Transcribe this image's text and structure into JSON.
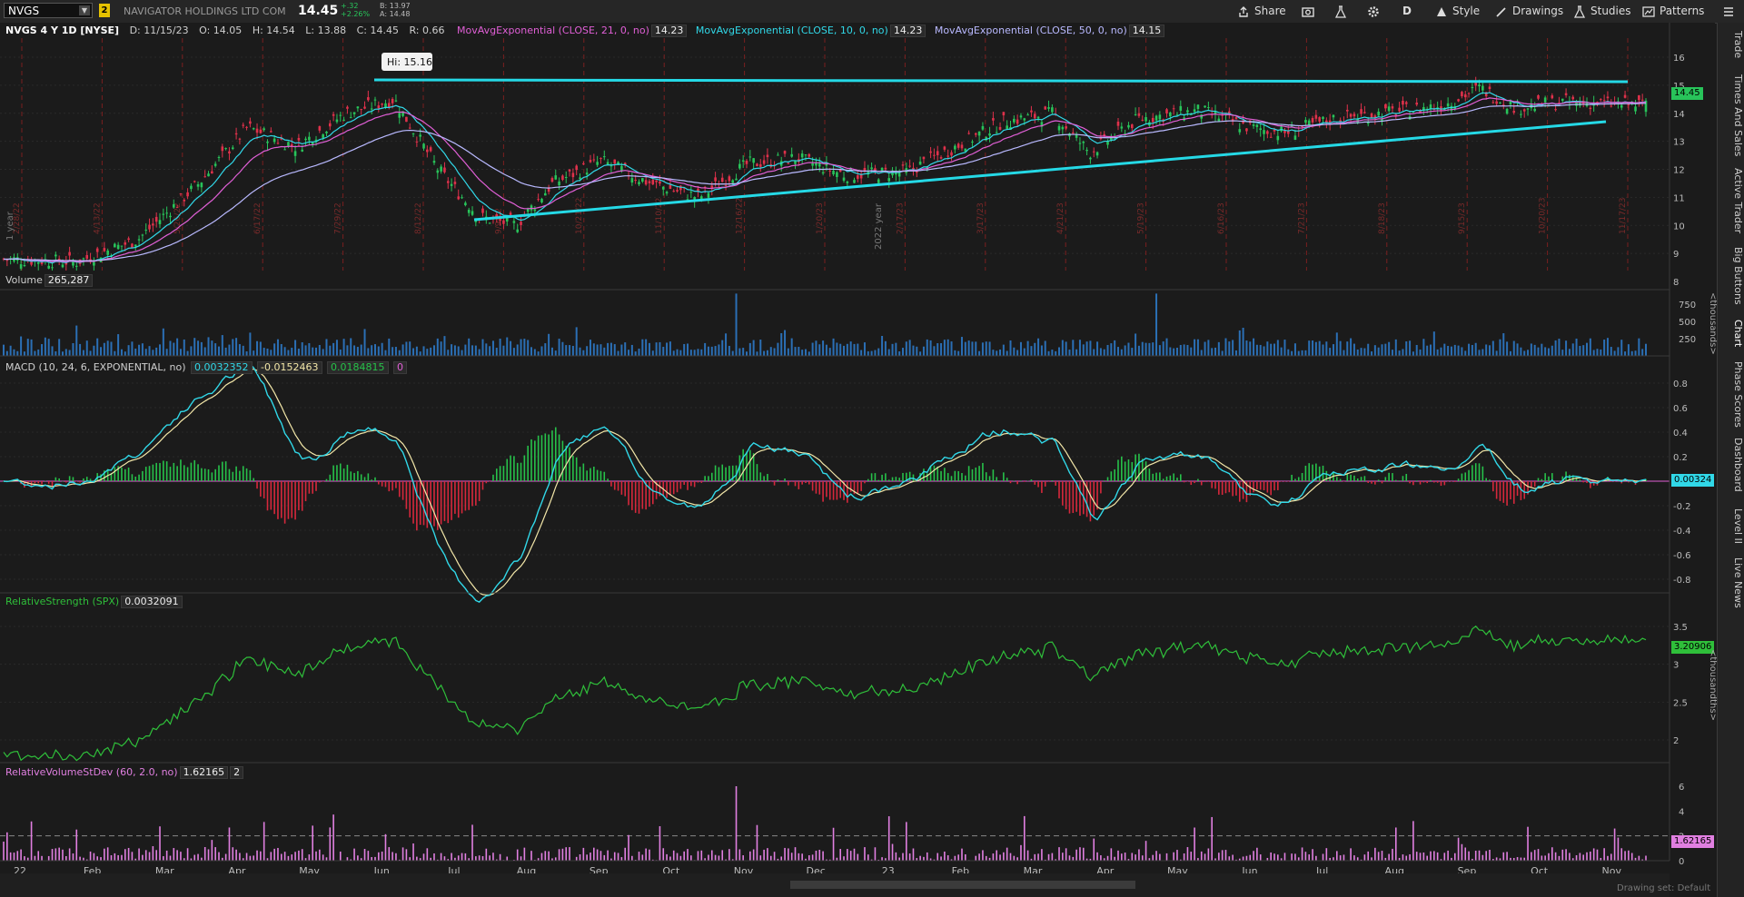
{
  "topbar": {
    "symbol": "NVGS",
    "link_badge": "2",
    "company": "NAVIGATOR HOLDINGS LTD COM",
    "last": "14.45",
    "change": "+.32",
    "change_pct": "+2.26%",
    "bid": "B: 13.97",
    "ask": "A: 14.48",
    "buttons": {
      "share": "Share",
      "aggregation": "D",
      "style": "Style",
      "drawings": "Drawings",
      "studies": "Studies",
      "patterns": "Patterns"
    }
  },
  "price_panel": {
    "title": "NVGS 4 Y 1D [NYSE]",
    "date": "D: 11/15/23",
    "open": "O: 14.05",
    "high": "H: 14.54",
    "low": "L: 13.88",
    "close": "C: 14.45",
    "range": "R: 0.66",
    "studies": [
      {
        "label": "MovAvgExponential (CLOSE, 21, 0, no)",
        "value": "14.23",
        "color": "#e05fd6"
      },
      {
        "label": "MovAvgExponential (CLOSE, 10, 0, no)",
        "value": "14.23",
        "color": "#31d8e8"
      },
      {
        "label": "MovAvgExponential (CLOSE, 50, 0, no)",
        "value": "14.15",
        "color": "#b9b9ff"
      }
    ],
    "hi_label": "Hi: 15.16",
    "last_tag": "14.45",
    "y_ticks": [
      "16",
      "15",
      "14",
      "13",
      "12",
      "11",
      "10",
      "9",
      "8"
    ],
    "year_label_1": "1 year",
    "year_label_2": "2022 year",
    "date_markers": [
      "2/28/22",
      "4/13/22",
      "5/26/22",
      "6/17/22",
      "7/29/22",
      "8/12/22",
      "9/9/22",
      "10/21/22",
      "11/10/22",
      "12/16/22",
      "1/20/23",
      "2/17/23",
      "3/17/23",
      "4/21/23",
      "5/19/23",
      "6/16/23",
      "7/21/23",
      "8/18/23",
      "9/15/23",
      "10/20/23",
      "11/17/23"
    ]
  },
  "volume_panel": {
    "label": "Volume",
    "value": "265,287",
    "y_ticks": [
      "750",
      "500",
      "250"
    ],
    "unit": "<thousands>"
  },
  "macd_panel": {
    "label": "MACD (10, 24, 6, EXPONENTIAL, no)",
    "values": [
      "0.0032352",
      "-0.0152463",
      "0.0184815",
      "0"
    ],
    "y_ticks": [
      "0.8",
      "0.6",
      "0.4",
      "0.2",
      "0",
      "-0.2",
      "-0.4",
      "-0.6",
      "-0.8"
    ],
    "last_tag": "0.00324"
  },
  "rs_panel": {
    "label": "RelativeStrength (SPX)",
    "value": "0.0032091",
    "y_ticks": [
      "3.5",
      "3",
      "2.5",
      "2"
    ],
    "last_tag": "3.20906",
    "unit": "<thousandths>"
  },
  "rvol_panel": {
    "label": "RelativeVolumeStDev (60, 2.0, no)",
    "values": [
      "1.62165",
      "2"
    ],
    "y_ticks": [
      "6",
      "4",
      "2",
      "0"
    ],
    "last_tag": "1.62165"
  },
  "x_axis": [
    "22",
    "Feb",
    "Mar",
    "Apr",
    "May",
    "Jun",
    "Jul",
    "Aug",
    "Sep",
    "Oct",
    "Nov",
    "Dec",
    "23",
    "Feb",
    "Mar",
    "Apr",
    "May",
    "Jun",
    "Jul",
    "Aug",
    "Sep",
    "Oct",
    "Nov"
  ],
  "side_tabs": [
    "Trade",
    "Times And Sales",
    "Active Trader",
    "Big Buttons",
    "Chart",
    "Phase Scores",
    "Dashboard",
    "Level II",
    "Live News"
  ],
  "drawing_set": "Drawing set: Default",
  "colors": {
    "up": "#28c45a",
    "down": "#e0314b",
    "ema21": "#e05fd6",
    "ema10": "#31d8e8",
    "ema50": "#b9b9ff",
    "trendline": "#25d9e6",
    "macd_hist_up": "#27c14a",
    "macd_hist_dn": "#d6283c",
    "rs_line": "#2fbf3a",
    "rvol": "#e07fe0"
  }
}
